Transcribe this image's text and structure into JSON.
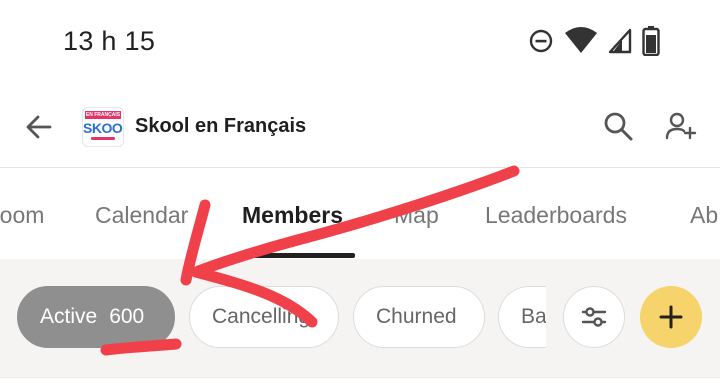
{
  "status_bar": {
    "time": "13 h 15",
    "icons": [
      "do-not-disturb-icon",
      "wifi-icon",
      "signal-icon",
      "battery-icon"
    ]
  },
  "app_bar": {
    "title": "Skool en Français",
    "logo": {
      "top_text": "EN FRANÇAIS",
      "main_text": "SKOOL"
    },
    "icons": [
      "back-arrow-icon",
      "search-icon",
      "add-member-icon"
    ]
  },
  "tabs": [
    {
      "label": "Classroom",
      "visible_label": "room"
    },
    {
      "label": "Calendar",
      "visible_label": "Calendar"
    },
    {
      "label": "Members",
      "visible_label": "Members",
      "active": true
    },
    {
      "label": "Map",
      "visible_label": "Map"
    },
    {
      "label": "Leaderboards",
      "visible_label": "Leaderboards"
    },
    {
      "label": "About",
      "visible_label": "Ab"
    }
  ],
  "filters": {
    "chips": [
      {
        "label": "Active",
        "count": "600",
        "active": true
      },
      {
        "label": "Cancelling",
        "visible_label": "Cancelling"
      },
      {
        "label": "Churned",
        "visible_label": "Churned"
      },
      {
        "label": "Banned",
        "visible_label": "Ba"
      }
    ],
    "icons": [
      "sliders-icon",
      "plus-icon"
    ]
  },
  "colors": {
    "active_chip": "#8f8f8f",
    "add_button": "#f7d36b",
    "annotation": "#f0404a",
    "logo_pink": "#e2336b",
    "logo_blue": "#2a6ed6"
  }
}
